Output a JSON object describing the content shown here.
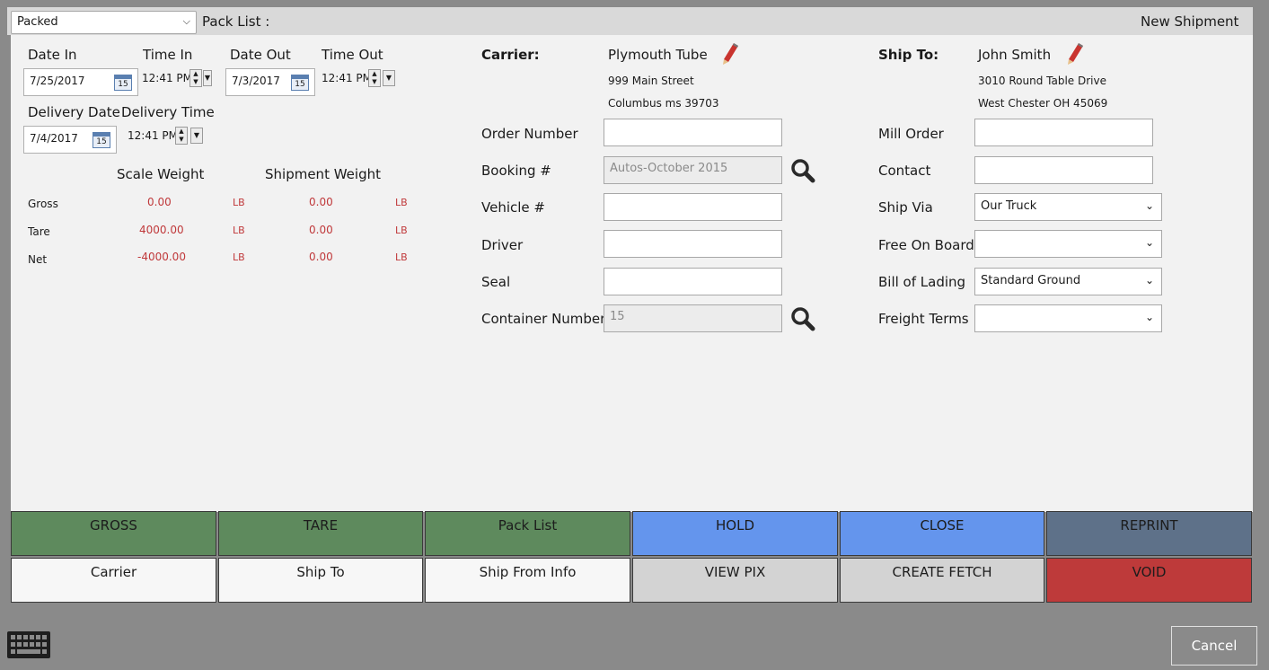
{
  "header": {
    "status_value": "Packed",
    "packlist_label": "Pack List :",
    "new_shipment_label": "New Shipment"
  },
  "dates": {
    "date_in_label": "Date In",
    "time_in_label": "Time In",
    "date_out_label": "Date Out",
    "time_out_label": "Time Out",
    "delivery_date_label": "Delivery Date",
    "delivery_time_label": "Delivery Time",
    "date_in": "7/25/2017",
    "time_in": "12:41 PM",
    "date_out": "7/3/2017",
    "time_out": "12:41 PM",
    "delivery_date": "7/4/2017",
    "delivery_time": "12:41 PM",
    "calendar_day": "15"
  },
  "weights": {
    "scale_weight_label": "Scale Weight",
    "shipment_weight_label": "Shipment Weight",
    "unit": "LB",
    "rows": [
      {
        "label": "Gross",
        "scale": "0.00",
        "shipment": "0.00"
      },
      {
        "label": "Tare",
        "scale": "4000.00",
        "shipment": "0.00"
      },
      {
        "label": "Net",
        "scale": "-4000.00",
        "shipment": "0.00"
      }
    ]
  },
  "carrier": {
    "label": "Carrier:",
    "name": "Plymouth Tube",
    "address1": "999 Main Street",
    "address2": "Columbus ms 39703"
  },
  "ship_to": {
    "label": "Ship To:",
    "name": "John Smith",
    "address1": "3010 Round Table Drive",
    "address2": "West Chester OH 45069"
  },
  "middle_fields": {
    "order_number_label": "Order Number",
    "order_number": "",
    "booking_label": "Booking #",
    "booking": "Autos-October 2015",
    "vehicle_label": "Vehicle #",
    "vehicle": "",
    "driver_label": "Driver",
    "driver": "",
    "seal_label": "Seal",
    "seal": "",
    "container_label": "Container Number",
    "container": "15"
  },
  "right_fields": {
    "mill_order_label": "Mill Order",
    "mill_order": "",
    "contact_label": "Contact",
    "contact": "",
    "ship_via_label": "Ship Via",
    "ship_via": "Our Truck",
    "fob_label": "Free On Board",
    "fob": "",
    "bol_label": "Bill of Lading",
    "bol": "Standard Ground",
    "freight_terms_label": "Freight Terms",
    "freight_terms": ""
  },
  "buttons": {
    "gross": "GROSS",
    "tare": "TARE",
    "pack_list": "Pack List",
    "hold": "HOLD",
    "close": "CLOSE",
    "reprint": "REPRINT",
    "carrier": "Carrier",
    "ship_to": "Ship To",
    "ship_from_info": "Ship From Info",
    "view_pix": "VIEW PIX",
    "create_fetch": "CREATE FETCH",
    "void": "VOID",
    "cancel": "Cancel"
  },
  "colors": {
    "green": "#5e8a5d",
    "blue": "#6495ed",
    "slate": "#5e7189",
    "red": "#be3a3a",
    "weight_red": "#c0393b"
  },
  "icons": [
    "calendar-icon",
    "search-icon",
    "pencil-icon",
    "keyboard-icon",
    "chevron-down-icon"
  ]
}
